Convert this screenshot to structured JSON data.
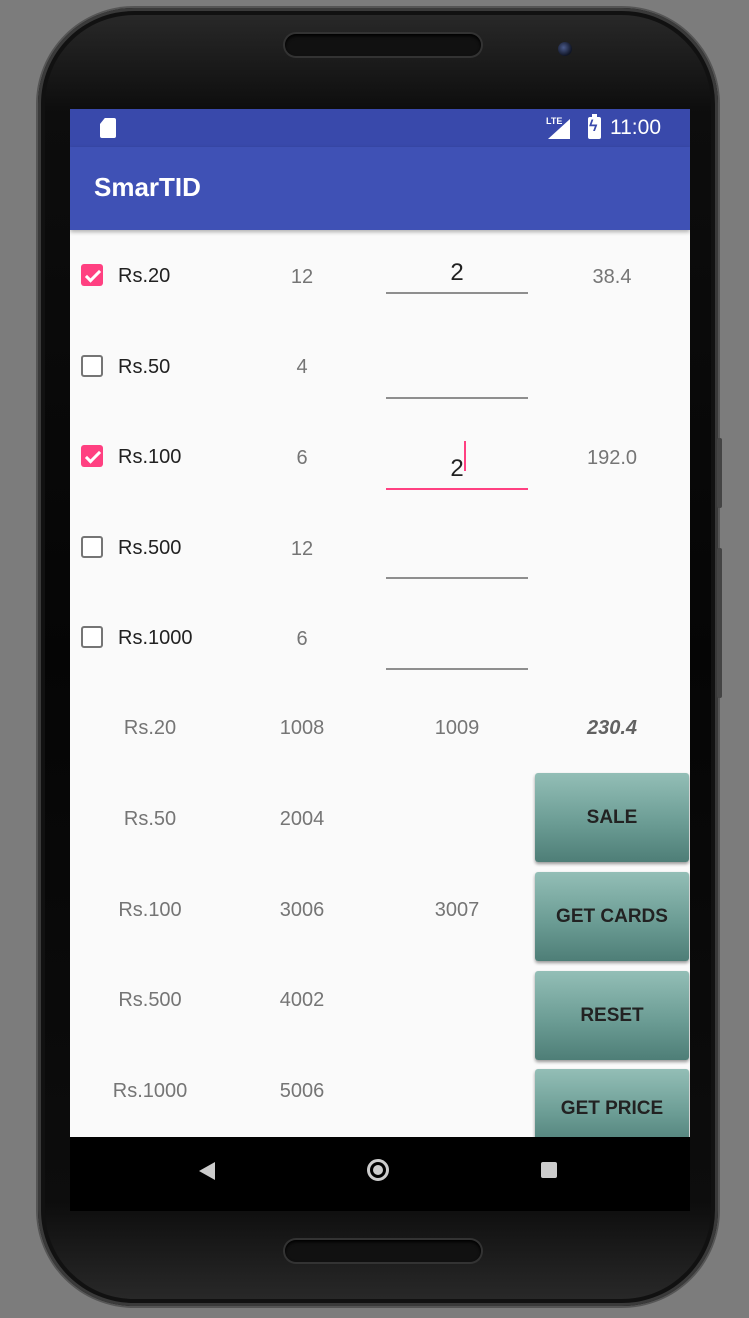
{
  "status_bar": {
    "network_label": "LTE",
    "time": "11:00"
  },
  "app_bar": {
    "title": "SmarTID"
  },
  "denominations": [
    {
      "label": "Rs.20",
      "checked": true,
      "count": "12",
      "quantity": "2",
      "price": "38.4"
    },
    {
      "label": "Rs.50",
      "checked": false,
      "count": "4",
      "quantity": "",
      "price": ""
    },
    {
      "label": "Rs.100",
      "checked": true,
      "count": "6",
      "quantity": "2",
      "price": "192.0"
    },
    {
      "label": "Rs.500",
      "checked": false,
      "count": "12",
      "quantity": "",
      "price": ""
    },
    {
      "label": "Rs.1000",
      "checked": false,
      "count": "6",
      "quantity": "",
      "price": ""
    }
  ],
  "card_table": [
    {
      "label": "Rs.20",
      "start": "1008",
      "end": "1009"
    },
    {
      "label": "Rs.50",
      "start": "2004",
      "end": ""
    },
    {
      "label": "Rs.100",
      "start": "3006",
      "end": "3007"
    },
    {
      "label": "Rs.500",
      "start": "4002",
      "end": ""
    },
    {
      "label": "Rs.1000",
      "start": "5006",
      "end": ""
    }
  ],
  "total_price": "230.4",
  "buttons": {
    "sale": "SALE",
    "get_cards": "GET CARDS",
    "reset": "RESET",
    "get_price": "GET PRICE"
  },
  "colors": {
    "primary": "#3f51b5",
    "primary_dark": "#3949ab",
    "accent": "#ff4081",
    "button": "#6c9d95"
  },
  "icons": [
    "sd-card-icon",
    "signal-icon",
    "battery-charging-icon",
    "back-icon",
    "home-icon",
    "recents-icon"
  ]
}
